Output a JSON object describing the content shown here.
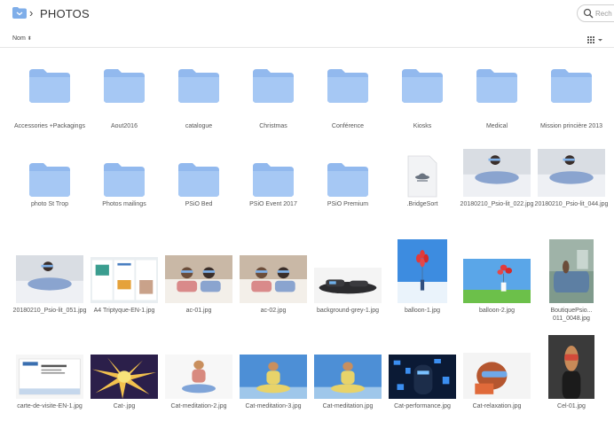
{
  "header": {
    "title": "PHOTOS",
    "search_placeholder": "Rech"
  },
  "toolbar": {
    "sort_label": "Nom"
  },
  "colors": {
    "folder": "#a6c8f4",
    "folder_tab": "#92b9ee",
    "accent": "#5b8fd6"
  },
  "items": [
    {
      "label": "Accessories +Packagings",
      "kind": "folder"
    },
    {
      "label": "Aout2016",
      "kind": "folder"
    },
    {
      "label": "catalogue",
      "kind": "folder"
    },
    {
      "label": "Christmas",
      "kind": "folder"
    },
    {
      "label": "Conférence",
      "kind": "folder"
    },
    {
      "label": "Kiosks",
      "kind": "folder"
    },
    {
      "label": "Medical",
      "kind": "folder"
    },
    {
      "label": "Mission princière 2013",
      "kind": "folder"
    },
    {
      "label": "photo St Trop",
      "kind": "folder"
    },
    {
      "label": "Photos mailings",
      "kind": "folder"
    },
    {
      "label": "PSiO Bed",
      "kind": "folder"
    },
    {
      "label": "PSiO Event 2017",
      "kind": "folder"
    },
    {
      "label": "PSiO Premium",
      "kind": "folder"
    },
    {
      "label": ".BridgeSort",
      "kind": "file",
      "icon": "bridge-file-icon"
    },
    {
      "label": "20180210_Psio-lit_022.jpg",
      "kind": "image",
      "icon": "bed-photo"
    },
    {
      "label": "20180210_Psio-lit_044.jpg",
      "kind": "image",
      "icon": "bed-photo"
    },
    {
      "label": "20180210_Psio-lit_051.jpg",
      "kind": "image",
      "icon": "bed-photo"
    },
    {
      "label": "A4 Triptyque-EN-1.jpg",
      "kind": "image",
      "icon": "brochure"
    },
    {
      "label": "ac-01.jpg",
      "kind": "image",
      "icon": "couple-bed"
    },
    {
      "label": "ac-02.jpg",
      "kind": "image",
      "icon": "couple-bed"
    },
    {
      "label": "background-grey-1.jpg",
      "kind": "image",
      "icon": "glasses"
    },
    {
      "label": "balloon-1.jpg",
      "kind": "image",
      "icon": "balloon"
    },
    {
      "label": "balloon-2.jpg",
      "kind": "image",
      "icon": "balloon-field"
    },
    {
      "label": "BoutiquePsio... 011_0048.jpg",
      "kind": "image",
      "icon": "shop"
    },
    {
      "label": "carte-de-visite-EN-1.jpg",
      "kind": "image",
      "icon": "card"
    },
    {
      "label": "Cat-.jpg",
      "kind": "image",
      "icon": "burst"
    },
    {
      "label": "Cat-meditation-2.jpg",
      "kind": "image",
      "icon": "meditation-white"
    },
    {
      "label": "Cat-meditation-3.jpg",
      "kind": "image",
      "icon": "meditation-blue"
    },
    {
      "label": "Cat-meditation.jpg",
      "kind": "image",
      "icon": "meditation-blue"
    },
    {
      "label": "Cat-performance.jpg",
      "kind": "image",
      "icon": "performance"
    },
    {
      "label": "Cat-relaxation.jpg",
      "kind": "image",
      "icon": "relaxation"
    },
    {
      "label": "Cel-01.jpg",
      "kind": "image",
      "icon": "portrait-dark"
    }
  ]
}
